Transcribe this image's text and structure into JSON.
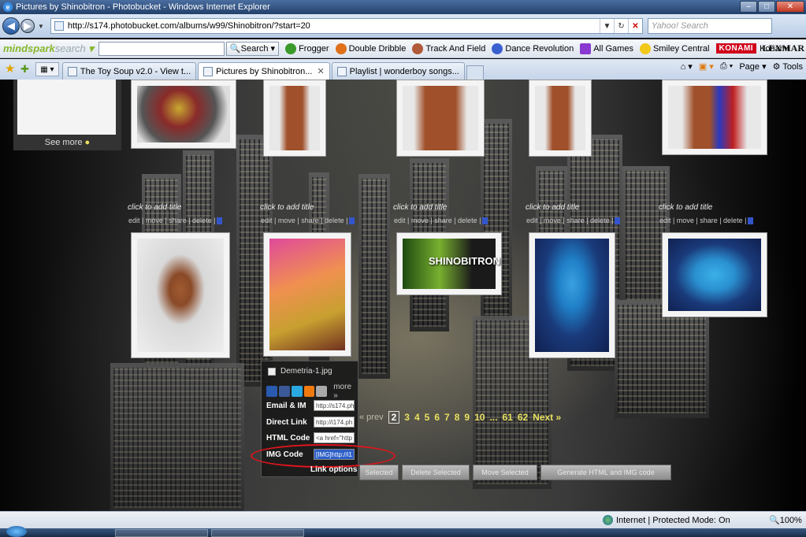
{
  "window": {
    "title": "Pictures by Shinobitron - Photobucket - Windows Internet Explorer"
  },
  "address": {
    "url": "http://s174.photobucket.com/albums/w99/Shinobitron/?start=20",
    "search_placeholder": "Yahoo! Search"
  },
  "mindspark": {
    "logo": "mindspark",
    "logo_suffix": "search",
    "search_button": "Search",
    "links": [
      "Frogger",
      "Double Dribble",
      "Track And Field",
      "Dance Revolution",
      "All Games",
      "Smiley Central"
    ],
    "konami_badge": "KONAMI",
    "konami_label": "Konami",
    "lexmark": "LEXMAR"
  },
  "tabs": [
    {
      "label": "The Toy Soup v2.0 - View t..."
    },
    {
      "label": "Pictures by Shinobitron..."
    },
    {
      "label": "Playlist | wonderboy songs..."
    }
  ],
  "commands": {
    "page": "Page",
    "tools": "Tools"
  },
  "sidebar": {
    "see_more": "See more"
  },
  "album": {
    "caption": "click to add title",
    "actions": "edit | move | share | delete |",
    "selected_file": "Demetria-1.jpg",
    "thumb_labels": [
      "SHINOBITRON"
    ]
  },
  "popup": {
    "more": "more »",
    "rows": [
      {
        "label": "Email & IM",
        "value": "http://s174.ph"
      },
      {
        "label": "Direct Link",
        "value": "http://i174.ph"
      },
      {
        "label": "HTML Code",
        "value": "<a href=\"http"
      },
      {
        "label": "IMG Code",
        "value": "[IMG]http://i1"
      }
    ],
    "link_options": "Link options"
  },
  "pager": {
    "prev": "« prev",
    "current": "2",
    "pages": [
      "3",
      "4",
      "5",
      "6",
      "7",
      "8",
      "9",
      "10",
      "...",
      "61",
      "62"
    ],
    "next": "Next »"
  },
  "bottom_buttons": [
    "Selected",
    "Delete Selected",
    "Move Selected",
    "Generate HTML and IMG code"
  ],
  "status": {
    "zone": "Internet | Protected Mode: On",
    "zoom": "100%"
  }
}
